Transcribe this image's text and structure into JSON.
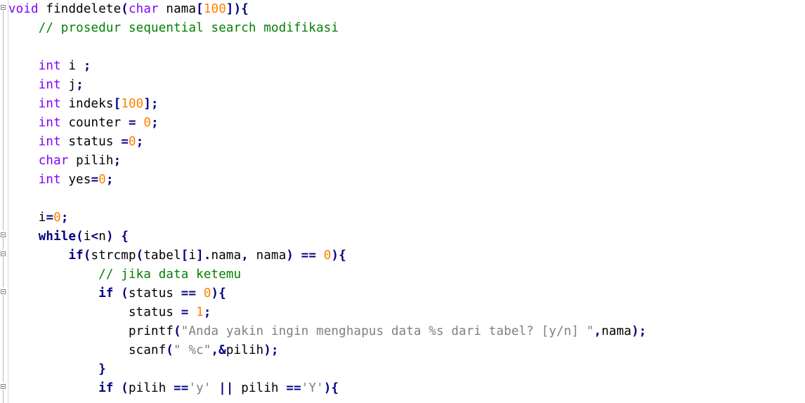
{
  "editor": {
    "lines": [
      [
        {
          "c": "kw",
          "t": "void"
        },
        {
          "c": "id",
          "t": " finddelete"
        },
        {
          "c": "op",
          "t": "("
        },
        {
          "c": "kw",
          "t": "char"
        },
        {
          "c": "id",
          "t": " nama"
        },
        {
          "c": "op",
          "t": "["
        },
        {
          "c": "num",
          "t": "100"
        },
        {
          "c": "op",
          "t": "]){"
        }
      ],
      [
        {
          "c": "cm",
          "t": "    // prosedur sequential search modifikasi"
        }
      ],
      [],
      [
        {
          "c": "kw",
          "t": "    int"
        },
        {
          "c": "id",
          "t": " i "
        },
        {
          "c": "op",
          "t": ";"
        }
      ],
      [
        {
          "c": "kw",
          "t": "    int"
        },
        {
          "c": "id",
          "t": " j"
        },
        {
          "c": "op",
          "t": ";"
        }
      ],
      [
        {
          "c": "kw",
          "t": "    int"
        },
        {
          "c": "id",
          "t": " indeks"
        },
        {
          "c": "op",
          "t": "["
        },
        {
          "c": "num",
          "t": "100"
        },
        {
          "c": "op",
          "t": "];"
        }
      ],
      [
        {
          "c": "kw",
          "t": "    int"
        },
        {
          "c": "id",
          "t": " counter "
        },
        {
          "c": "op",
          "t": "="
        },
        {
          "c": "id",
          "t": " "
        },
        {
          "c": "num",
          "t": "0"
        },
        {
          "c": "op",
          "t": ";"
        }
      ],
      [
        {
          "c": "kw",
          "t": "    int"
        },
        {
          "c": "id",
          "t": " status "
        },
        {
          "c": "op",
          "t": "="
        },
        {
          "c": "num",
          "t": "0"
        },
        {
          "c": "op",
          "t": ";"
        }
      ],
      [
        {
          "c": "kw",
          "t": "    char"
        },
        {
          "c": "id",
          "t": " pilih"
        },
        {
          "c": "op",
          "t": ";"
        }
      ],
      [
        {
          "c": "kw",
          "t": "    int"
        },
        {
          "c": "id",
          "t": " yes"
        },
        {
          "c": "op",
          "t": "="
        },
        {
          "c": "num",
          "t": "0"
        },
        {
          "c": "op",
          "t": ";"
        }
      ],
      [],
      [
        {
          "c": "id",
          "t": "    i"
        },
        {
          "c": "op",
          "t": "="
        },
        {
          "c": "num",
          "t": "0"
        },
        {
          "c": "op",
          "t": ";"
        }
      ],
      [
        {
          "c": "kb",
          "t": "    while"
        },
        {
          "c": "op",
          "t": "("
        },
        {
          "c": "id",
          "t": "i"
        },
        {
          "c": "op",
          "t": "<"
        },
        {
          "c": "id",
          "t": "n"
        },
        {
          "c": "op",
          "t": ")"
        },
        {
          "c": "id",
          "t": " "
        },
        {
          "c": "op",
          "t": "{"
        }
      ],
      [
        {
          "c": "kb",
          "t": "        if"
        },
        {
          "c": "op",
          "t": "("
        },
        {
          "c": "id",
          "t": "strcmp"
        },
        {
          "c": "op",
          "t": "("
        },
        {
          "c": "id",
          "t": "tabel"
        },
        {
          "c": "op",
          "t": "["
        },
        {
          "c": "id",
          "t": "i"
        },
        {
          "c": "op",
          "t": "]."
        },
        {
          "c": "id",
          "t": "nama"
        },
        {
          "c": "op",
          "t": ","
        },
        {
          "c": "id",
          "t": " nama"
        },
        {
          "c": "op",
          "t": ")"
        },
        {
          "c": "id",
          "t": " "
        },
        {
          "c": "op",
          "t": "=="
        },
        {
          "c": "id",
          "t": " "
        },
        {
          "c": "num",
          "t": "0"
        },
        {
          "c": "op",
          "t": "){"
        }
      ],
      [
        {
          "c": "cm",
          "t": "            // jika data ketemu"
        }
      ],
      [
        {
          "c": "kb",
          "t": "            if"
        },
        {
          "c": "id",
          "t": " "
        },
        {
          "c": "op",
          "t": "("
        },
        {
          "c": "id",
          "t": "status "
        },
        {
          "c": "op",
          "t": "=="
        },
        {
          "c": "id",
          "t": " "
        },
        {
          "c": "num",
          "t": "0"
        },
        {
          "c": "op",
          "t": "){"
        }
      ],
      [
        {
          "c": "id",
          "t": "                status "
        },
        {
          "c": "op",
          "t": "="
        },
        {
          "c": "id",
          "t": " "
        },
        {
          "c": "num",
          "t": "1"
        },
        {
          "c": "op",
          "t": ";"
        }
      ],
      [
        {
          "c": "id",
          "t": "                printf"
        },
        {
          "c": "op",
          "t": "("
        },
        {
          "c": "str",
          "t": "\"Anda yakin ingin menghapus data %s dari tabel? [y/n] \""
        },
        {
          "c": "op",
          "t": ","
        },
        {
          "c": "id",
          "t": "nama"
        },
        {
          "c": "op",
          "t": ");"
        }
      ],
      [
        {
          "c": "id",
          "t": "                scanf"
        },
        {
          "c": "op",
          "t": "("
        },
        {
          "c": "str",
          "t": "\" %c\""
        },
        {
          "c": "op",
          "t": ",&"
        },
        {
          "c": "id",
          "t": "pilih"
        },
        {
          "c": "op",
          "t": ");"
        }
      ],
      [
        {
          "c": "op",
          "t": "            }"
        }
      ],
      [
        {
          "c": "kb",
          "t": "            if"
        },
        {
          "c": "id",
          "t": " "
        },
        {
          "c": "op",
          "t": "("
        },
        {
          "c": "id",
          "t": "pilih "
        },
        {
          "c": "op",
          "t": "=="
        },
        {
          "c": "str",
          "t": "'y'"
        },
        {
          "c": "id",
          "t": " "
        },
        {
          "c": "op",
          "t": "||"
        },
        {
          "c": "id",
          "t": " pilih "
        },
        {
          "c": "op",
          "t": "=="
        },
        {
          "c": "str",
          "t": "'Y'"
        },
        {
          "c": "op",
          "t": "){"
        }
      ]
    ]
  }
}
